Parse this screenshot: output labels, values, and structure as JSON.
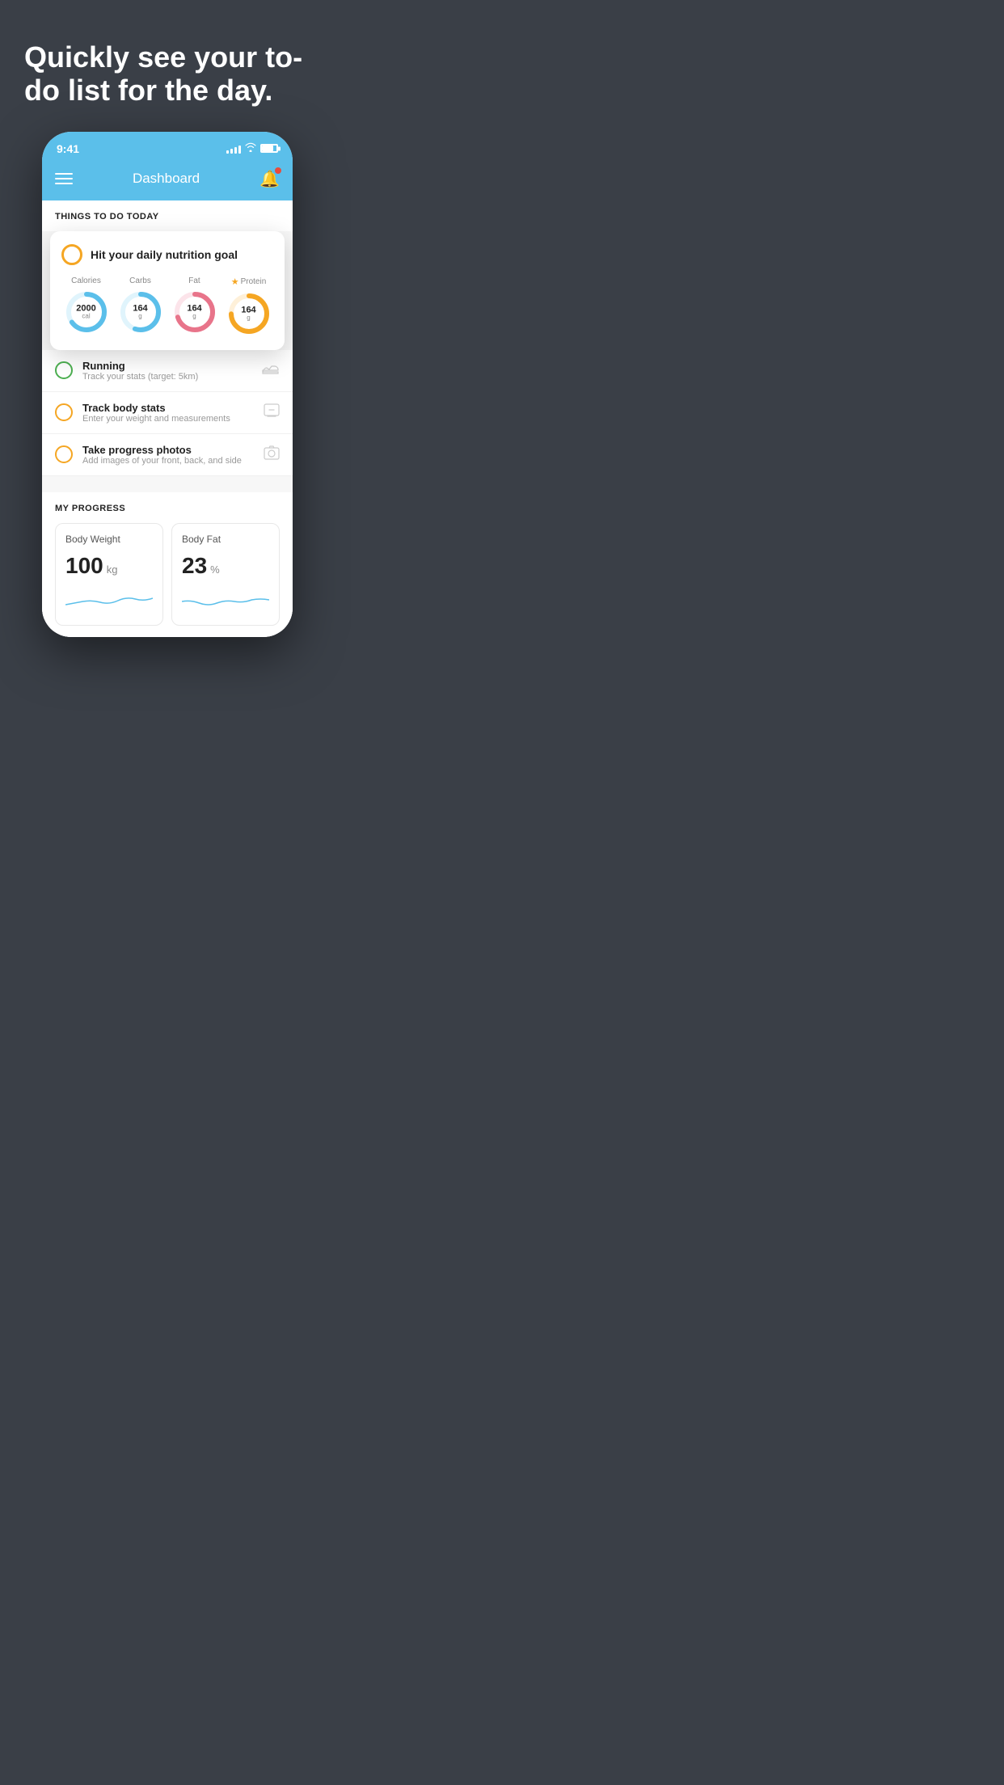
{
  "hero": {
    "title": "Quickly see your to-do list for the day."
  },
  "phone": {
    "status_bar": {
      "time": "9:41"
    },
    "header": {
      "title": "Dashboard"
    },
    "things_header": "THINGS TO DO TODAY",
    "nutrition_card": {
      "title": "Hit your daily nutrition goal",
      "stats": [
        {
          "label": "Calories",
          "value": "2000",
          "unit": "cal",
          "color": "#5bbfea",
          "pct": 65
        },
        {
          "label": "Carbs",
          "value": "164",
          "unit": "g",
          "color": "#5bbfea",
          "pct": 55
        },
        {
          "label": "Fat",
          "value": "164",
          "unit": "g",
          "color": "#e8748a",
          "pct": 70
        },
        {
          "label": "Protein",
          "value": "164",
          "unit": "g",
          "color": "#f5a623",
          "pct": 75,
          "star": true
        }
      ]
    },
    "todo_items": [
      {
        "name": "Running",
        "sub": "Track your stats (target: 5km)",
        "circle_color": "green",
        "icon": "shoe"
      },
      {
        "name": "Track body stats",
        "sub": "Enter your weight and measurements",
        "circle_color": "yellow",
        "icon": "scale"
      },
      {
        "name": "Take progress photos",
        "sub": "Add images of your front, back, and side",
        "circle_color": "yellow",
        "icon": "photo"
      }
    ],
    "progress": {
      "title": "MY PROGRESS",
      "cards": [
        {
          "title": "Body Weight",
          "value": "100",
          "unit": "kg"
        },
        {
          "title": "Body Fat",
          "value": "23",
          "unit": "%"
        }
      ]
    }
  }
}
